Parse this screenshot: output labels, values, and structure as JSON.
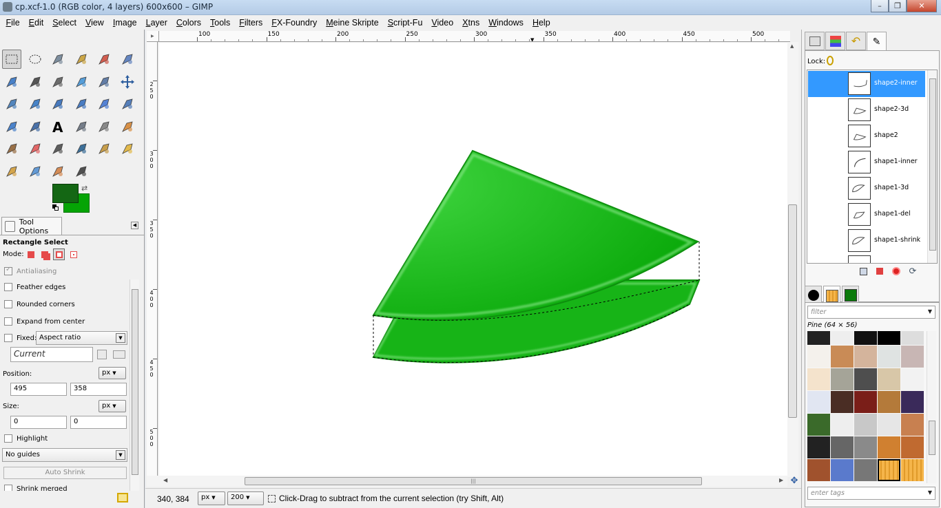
{
  "window": {
    "title": "cp.xcf-1.0 (RGB color, 4 layers) 600x600 – GIMP",
    "minimize": "–",
    "maximize": "❐",
    "close": "✕"
  },
  "menu": [
    "File",
    "Edit",
    "Select",
    "View",
    "Image",
    "Layer",
    "Colors",
    "Tools",
    "Filters",
    "FX-Foundry",
    "Meine Skripte",
    "Script-Fu",
    "Video",
    "Xtns",
    "Windows",
    "Help"
  ],
  "toolbox": {
    "tools": [
      "rect-select-tool",
      "ellipse-select-tool",
      "free-select-tool",
      "fuzzy-select-tool",
      "select-by-color-tool",
      "scissors-select-tool",
      "foreground-select-tool",
      "paths-tool",
      "color-picker-tool",
      "zoom-tool",
      "measure-tool",
      "move-tool",
      "align-tool",
      "crop-tool",
      "rotate-tool",
      "scale-tool",
      "shear-tool",
      "perspective-tool",
      "flip-tool",
      "cage-transform-tool",
      "text-tool",
      "bucket-fill-tool",
      "blend-tool",
      "pencil-tool",
      "paintbrush-tool",
      "eraser-tool",
      "airbrush-tool",
      "ink-tool",
      "clone-tool",
      "heal-tool",
      "perspective-clone-tool",
      "blur-tool",
      "smudge-tool",
      "dodge-burn-tool"
    ],
    "fg_color": "#146714",
    "bg_color": "#05a405"
  },
  "tool_options": {
    "tab_label": "Tool Options",
    "tool_name": "Rectangle Select",
    "mode_label": "Mode:",
    "antialiasing": "Antialiasing",
    "feather_edges": "Feather edges",
    "rounded_corners": "Rounded corners",
    "expand_from_center": "Expand from center",
    "fixed_label": "Fixed:",
    "fixed_value": "Aspect ratio",
    "current_value": "Current",
    "position_label": "Position:",
    "position_unit": "px",
    "position_x": "495",
    "position_y": "358",
    "size_label": "Size:",
    "size_unit": "px",
    "size_w": "0",
    "size_h": "0",
    "highlight": "Highlight",
    "guides": "No guides",
    "auto_shrink": "Auto Shrink",
    "shrink_merged": "Shrink merged"
  },
  "canvas": {
    "ruler_labels": [
      "100",
      "150",
      "200",
      "250",
      "300",
      "350",
      "400",
      "450",
      "500"
    ],
    "vruler_labels": [
      "2 5 0",
      "3 0 0",
      "3 5 0",
      "4 0 0",
      "4 5 0",
      "5 0 0"
    ],
    "fg_shape_color": "#1fbf1f",
    "shape_edge_color": "#0d8f0d"
  },
  "status": {
    "coords": "340, 384",
    "unit": "px",
    "zoom": "200",
    "message": "Click-Drag to subtract from the current selection (try Shift, Alt)"
  },
  "layers": {
    "lock_label": "Lock:",
    "items": [
      {
        "name": "shape2-inner",
        "selected": true
      },
      {
        "name": "shape2-3d",
        "selected": false
      },
      {
        "name": "shape2",
        "selected": false
      },
      {
        "name": "shape1-inner",
        "selected": false
      },
      {
        "name": "shape1-3d",
        "selected": false
      },
      {
        "name": "shape1-del",
        "selected": false
      },
      {
        "name": "shape1-shrink",
        "selected": false
      }
    ]
  },
  "patterns": {
    "filter_placeholder": "filter",
    "selected_name": "Pine (64 × 56)",
    "tags_placeholder": "enter tags"
  }
}
